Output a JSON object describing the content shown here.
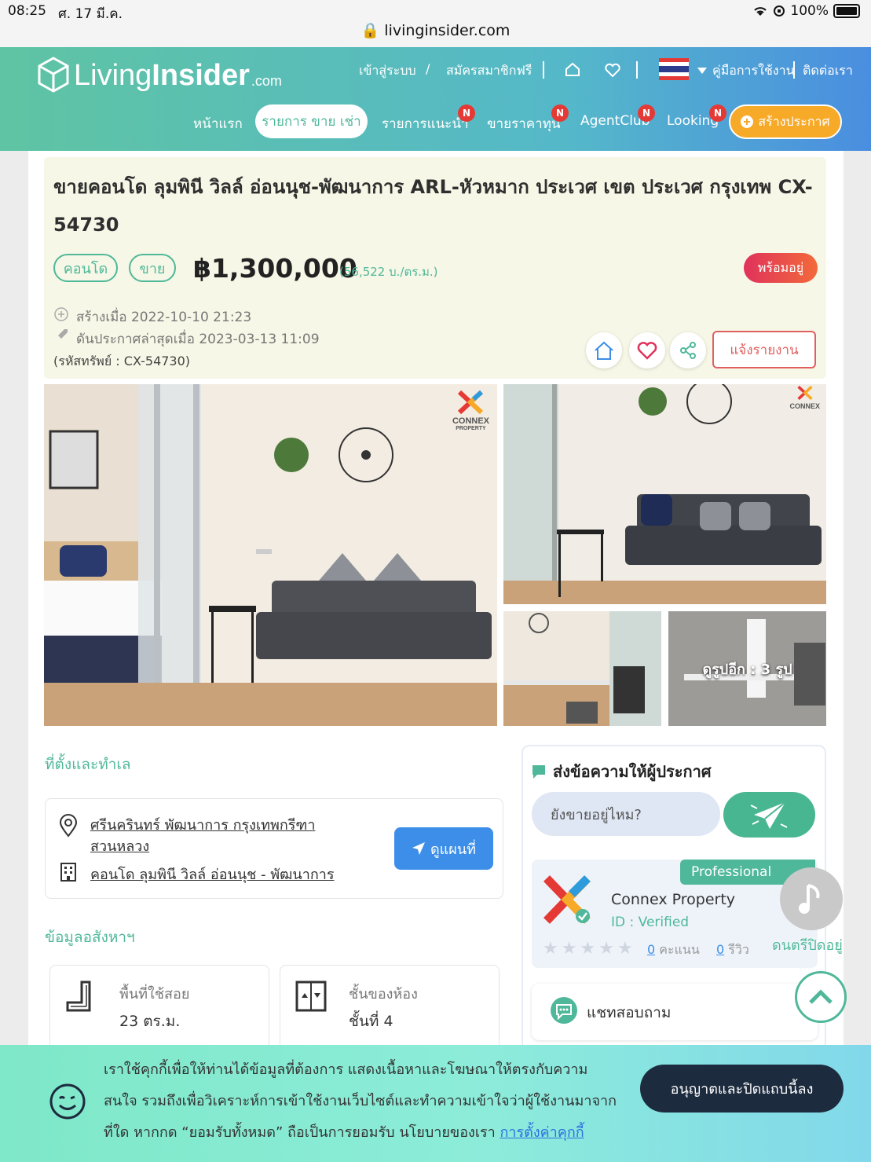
{
  "statusbar": {
    "time": "08:25",
    "date": "ศ. 17 มี.ค.",
    "url": "livinginsider.com",
    "battery": "100%"
  },
  "header": {
    "logo": {
      "part1": "Living",
      "part2": "Insider",
      "part3": ".com"
    },
    "top_links": {
      "login": "เข้าสู่ระบบ",
      "sep": "/",
      "register": "สมัครสมาชิกฟรี",
      "manual": "คู่มือการใช้งาน",
      "contact": "ติดต่อเรา"
    },
    "nav": {
      "home": "หน้าแรก",
      "active": "รายการ ขาย เช่า",
      "recommended": "รายการแนะนำ",
      "investor": "ขายราคาทุน",
      "agentclub": "AgentClub",
      "looking": "Looking",
      "badge": "N",
      "create": "สร้างประกาศ"
    },
    "colors": {
      "green": "#5fc4a3",
      "blue": "#4a8ee0",
      "orange": "#f7a928",
      "badge": "#e53935"
    }
  },
  "listing": {
    "title": "ขายคอนโด ลุมพินี วิลล์ อ่อนนุช-พัฒนาการ ARL-หัวหมาก ประเวศ เขต ประเวศ กรุงเทพ CX-54730",
    "tag_type": "คอนโด",
    "tag_sale": "ขาย",
    "price": "฿1,300,000",
    "price_per_sqm": "(56,522 บ./ตร.ม.)",
    "status": "พร้อมอยู่",
    "created": "สร้างเมื่อ 2022-10-10 21:23",
    "bumped": "ดันประกาศล่าสุดเมื่อ 2023-03-13 11:09",
    "ref": "(รหัสทรัพย์ : CX-54730)",
    "report": "แจ้งรายงาน"
  },
  "photos": {
    "watermark_main": "CONNEX",
    "watermark_sub": "PROPERTY",
    "more": "ดูรูปอีก : 3 รูป"
  },
  "location": {
    "heading": "ที่ตั้งและทำเล",
    "line1": "ศรีนครินทร์ พัฒนาการ กรุงเทพกรีฑา",
    "line2": "สวนหลวง",
    "project": "คอนโด ลุมพินี วิลล์ อ่อนนุช - พัฒนาการ",
    "map_button": "ดูแผนที่"
  },
  "property_info": {
    "heading": "ข้อมูลอสังหาฯ",
    "area_label": "พื้นที่ใช้สอย",
    "area_value": "23 ตร.ม.",
    "floor_label": "ชั้นของห้อง",
    "floor_value": "ชั้นที่ 4"
  },
  "contact": {
    "heading": "ส่งข้อความให้ผู้ประกาศ",
    "message_placeholder": "ยังขายอยู่ไหม?",
    "badge": "Professional",
    "agent_name": "Connex Property",
    "agent_id": "ID : Verified",
    "score": "0",
    "score_label": "คะแนน",
    "reviews": "0",
    "reviews_label": "รีวิว",
    "chat": "แชทสอบถาม",
    "music": "ดนตรีปิดอยู่"
  },
  "cookie": {
    "text1": "เราใช้คุกกี้เพื่อให้ท่านได้ข้อมูลที่ต้องการ แสดงเนื้อหาและโฆษณาให้ตรงกับความ",
    "text2": "สนใจ รวมถึงเพื่อวิเคราะห์การเข้าใช้งานเว็บไซต์และทำความเข้าใจว่าผู้ใช้งานมาจาก",
    "text3": "ที่ใด หากกด “ยอมรับทั้งหมด” ถือเป็นการยอมรับ นโยบายของเรา",
    "link": "การตั้งค่าคุกกี้",
    "accept": "อนุญาตและปิดแถบนี้ลง"
  }
}
